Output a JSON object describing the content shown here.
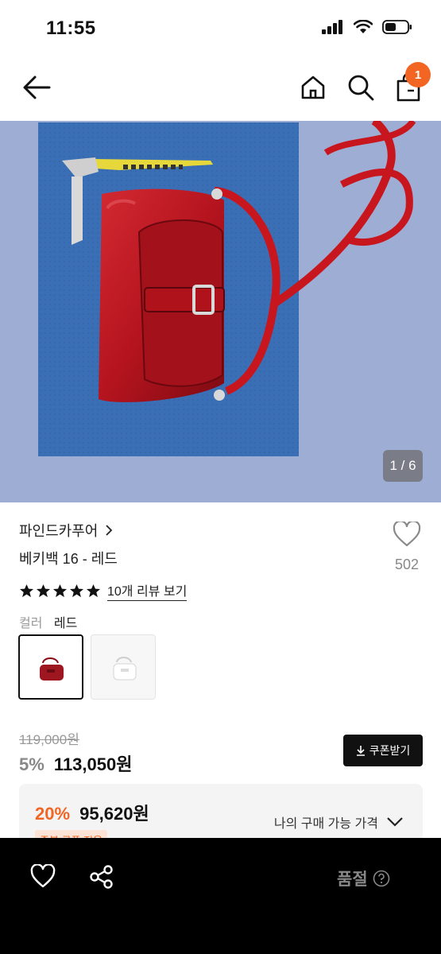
{
  "status": {
    "time": "11:55"
  },
  "nav": {
    "cart_count": "1"
  },
  "gallery": {
    "counter": "1 / 6"
  },
  "product": {
    "brand": "파인드카푸어",
    "name": "베키백 16 - 레드",
    "like_count": "502",
    "rating_stars": 5,
    "review_link": "10개 리뷰 보기",
    "color_label": "컬러",
    "color_value": "레드",
    "original_price": "119,000원",
    "discount": "5%",
    "price": "113,050원",
    "coupon_button": "쿠폰받기"
  },
  "promo": {
    "discount": "20%",
    "price": "95,620원",
    "badge": "중복 쿠폰 적용",
    "my_price_label": "나의 구매 가능 가격"
  },
  "bottom_bar": {
    "soldout_label": "품절"
  },
  "colors": {
    "accent": "#f26522",
    "hero_background": "#9faed3",
    "bag_red": "#b0121c"
  }
}
